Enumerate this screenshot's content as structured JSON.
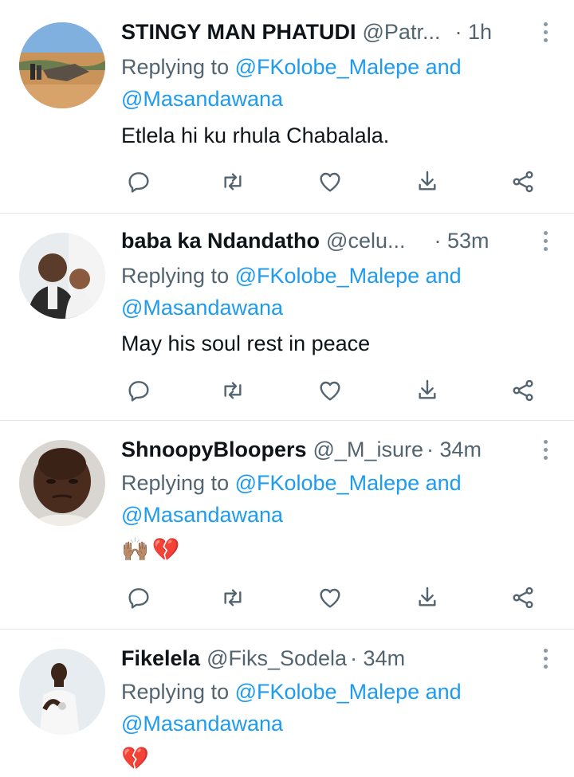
{
  "tweets": [
    {
      "name": "STINGY MAN PHATUDI",
      "handle": "@Patr...",
      "time": "· 1h",
      "replying_prefix": "Replying to ",
      "mention_1": "@FKolobe_Malepe",
      "and_word": " and",
      "mention_2": "@Masandawana",
      "text": "Etlela hi  ku rhula Chabalala."
    },
    {
      "name": "baba ka Ndandatho",
      "handle": "@celu...",
      "time": "· 53m",
      "replying_prefix": "Replying to ",
      "mention_1": "@FKolobe_Malepe",
      "and_word": " and",
      "mention_2": "@Masandawana",
      "text": "May his soul rest in peace"
    },
    {
      "name": "ShnoopyBloopers",
      "handle": "@_M_isure",
      "time": " · 34m",
      "replying_prefix": "Replying to ",
      "mention_1": "@FKolobe_Malepe",
      "and_word": " and",
      "mention_2": "@Masandawana",
      "text": "🙌🏽💔"
    },
    {
      "name": "Fikelela",
      "handle": "@Fiks_Sodela",
      "time": " · 34m",
      "replying_prefix": "Replying to ",
      "mention_1": "@FKolobe_Malepe",
      "and_word": " and",
      "mention_2": "@Masandawana",
      "text": "💔"
    }
  ],
  "icons": {
    "reply": "reply-icon",
    "retweet": "retweet-icon",
    "like": "heart-icon",
    "bookmark": "bookmark-download-icon",
    "share": "share-icon",
    "more": "more-vertical-icon"
  },
  "colors": {
    "link": "#1d9bf0",
    "secondary_text": "#536471",
    "primary_text": "#0f1419",
    "divider": "#e3e7ea"
  }
}
